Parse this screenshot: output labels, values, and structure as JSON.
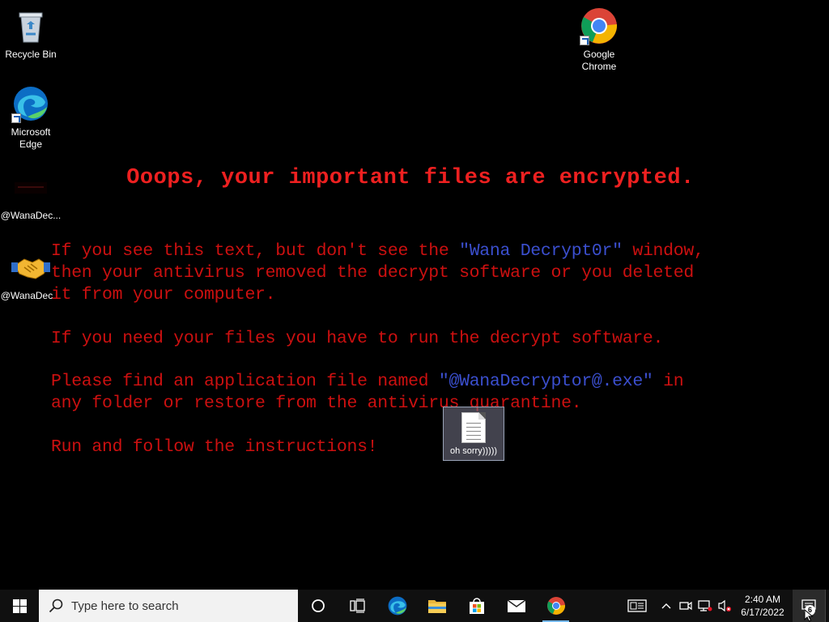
{
  "desktop": {
    "icons": [
      {
        "label": "Recycle Bin"
      },
      {
        "label": "Microsoft Edge"
      },
      {
        "label": "@WanaDec..."
      },
      {
        "label": "@WanaDec..."
      },
      {
        "label": "Google Chrome"
      }
    ],
    "selected_file": {
      "label": "oh sorry)))))"
    }
  },
  "ransom": {
    "title": "Ooops, your important files are encrypted.",
    "p1_l1_a": "If you see this text, but don't see the ",
    "p1_l1_b": "\"Wana Decrypt0r\"",
    "p1_l1_c": " window,",
    "p1_l2": "then your antivirus removed the decrypt software or you deleted",
    "p1_l3": "it from your computer.",
    "p2": "If you need your files you have to run the decrypt software.",
    "p3_l1_a": "Please find an application file named ",
    "p3_l1_b": "\"@WanaDecryptor@.exe\"",
    "p3_l1_c": " in",
    "p3_l2": "any folder or restore from the antivirus quarantine.",
    "p4": "Run and follow the instructions!",
    "colors": {
      "red": "#cc1010",
      "title_red": "#ee2020",
      "blue": "#3b4fcf"
    }
  },
  "taskbar": {
    "search_placeholder": "Type here to search",
    "apps": [
      "task-view",
      "edge",
      "file-explorer",
      "microsoft-store",
      "mail",
      "chrome"
    ],
    "clock": {
      "time": "2:40 AM",
      "date": "6/17/2022"
    },
    "notification_count": "6"
  }
}
